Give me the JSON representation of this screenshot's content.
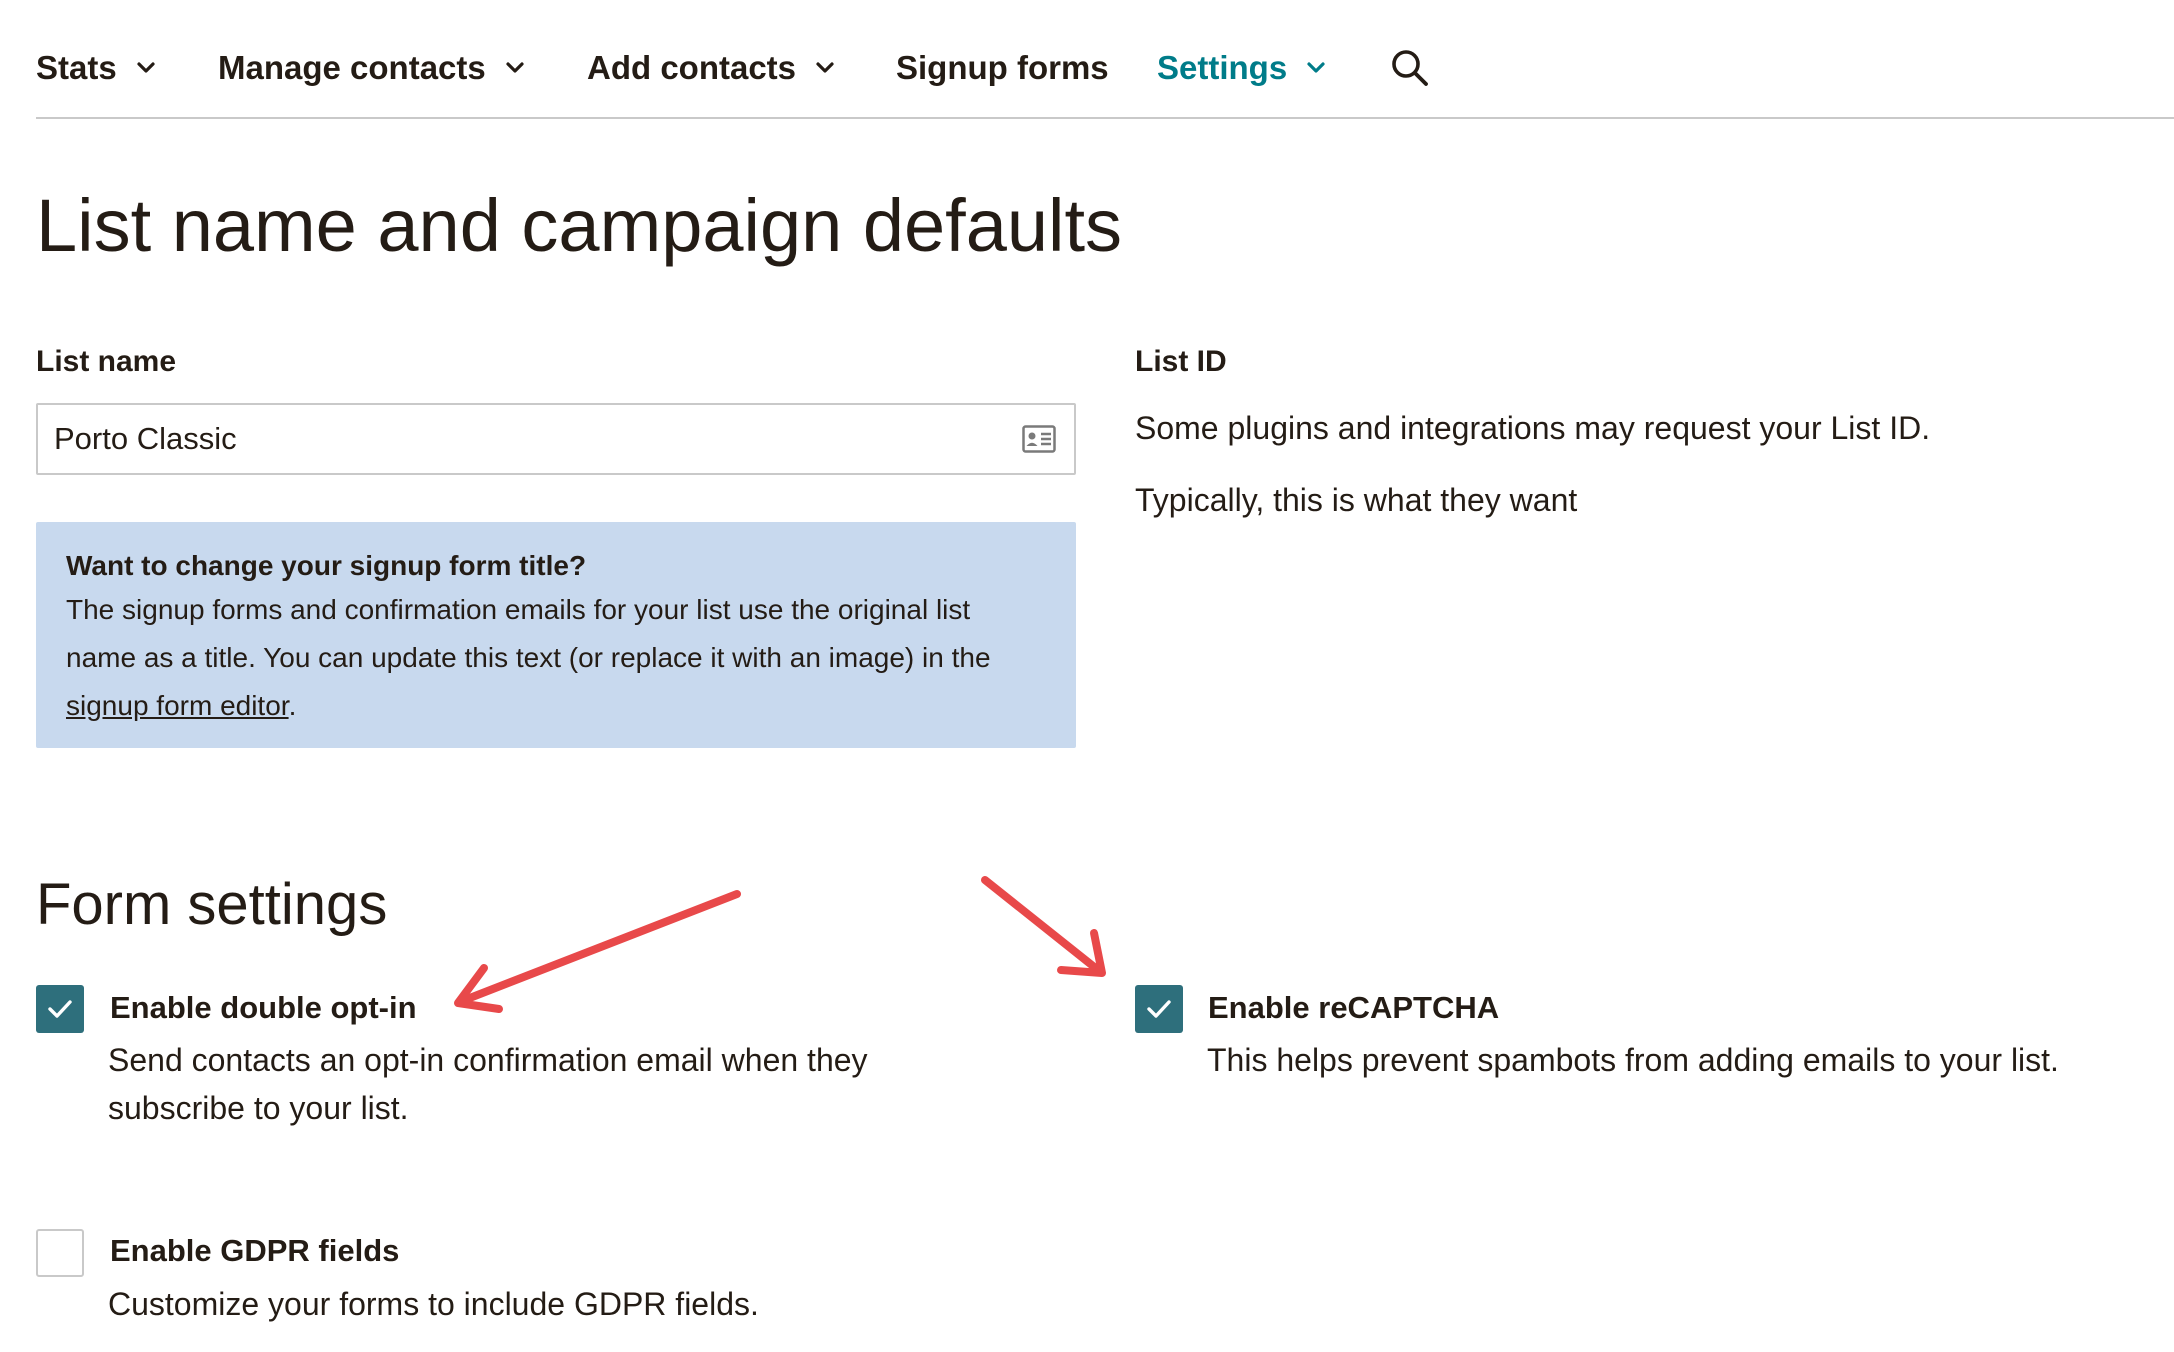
{
  "nav": {
    "items": [
      {
        "label": "Stats",
        "has_dropdown": true
      },
      {
        "label": "Manage contacts",
        "has_dropdown": true
      },
      {
        "label": "Add contacts",
        "has_dropdown": true
      },
      {
        "label": "Signup forms",
        "has_dropdown": false
      },
      {
        "label": "Settings",
        "has_dropdown": true,
        "active": true
      }
    ],
    "search_icon": "search-icon",
    "active_color": "#007c89"
  },
  "page": {
    "title": "List name and campaign defaults"
  },
  "list_name": {
    "label": "List name",
    "value": "Porto Classic",
    "icon": "contact-card-icon"
  },
  "info_box": {
    "title": "Want to change your signup form title?",
    "text_before": "The signup forms and confirmation emails for your list use the original list name as a title. You can update this text (or replace it with an image) in the ",
    "link": "signup form editor",
    "text_after": ".",
    "background": "#c8d9ee"
  },
  "list_id": {
    "label": "List ID",
    "line1": "Some plugins and integrations may request your List ID.",
    "line2": "Typically, this is what they want"
  },
  "form_settings": {
    "title": "Form settings",
    "options": [
      {
        "label": "Enable double opt-in",
        "description": "Send contacts an opt-in confirmation email when they subscribe to your list.",
        "checked": true
      },
      {
        "label": "Enable reCAPTCHA",
        "description": "This helps prevent spambots from adding emails to your list.",
        "checked": true
      },
      {
        "label": "Enable GDPR fields",
        "description": "Customize your forms to include GDPR fields.",
        "checked": false
      }
    ],
    "checkbox_color": "#2e6f7c",
    "annotation_arrow_color": "#e8494a"
  }
}
